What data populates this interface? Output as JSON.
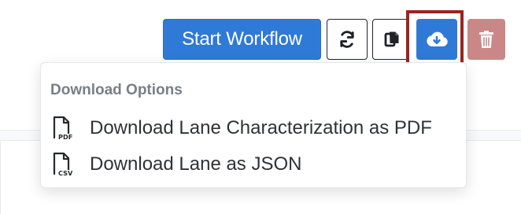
{
  "toolbar": {
    "start_workflow_label": "Start Workflow",
    "refresh_icon": "refresh-icon",
    "copy_icon": "copy-icon",
    "download_icon": "cloud-download-icon",
    "delete_icon": "trash-icon"
  },
  "download_menu": {
    "header": "Download Options",
    "items": [
      {
        "label": "Download Lane Characterization as PDF",
        "icon": "pdf-file-icon",
        "icon_text": "PDF"
      },
      {
        "label": "Download Lane as JSON",
        "icon": "csv-file-icon",
        "icon_text": "CSV"
      }
    ]
  },
  "colors": {
    "primary": "#2f7ad6",
    "highlight_border": "#9b241f",
    "delete": "#c98886",
    "menu_text": "#2f3236",
    "menu_header": "#777f87"
  }
}
